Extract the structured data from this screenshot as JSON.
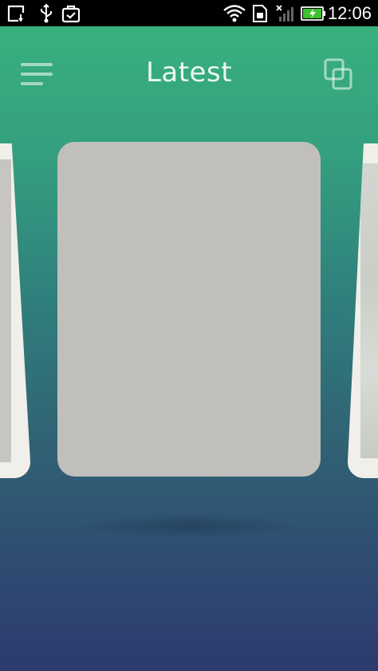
{
  "status_bar": {
    "time": "12:06",
    "icons": [
      "screenshot-icon",
      "usb-icon",
      "briefcase-icon",
      "wifi-icon",
      "sim-card-icon",
      "signal-icon",
      "battery-charging-icon"
    ]
  },
  "app_bar": {
    "title": "Latest",
    "menu_icon": "hamburger-menu-icon",
    "action_icon": "copy-icon"
  },
  "colors": {
    "gradient_top": "#38b47e",
    "gradient_bottom": "#2d3a6e",
    "card_placeholder": "#c1bfbb",
    "card_frame": "#f1efea"
  },
  "carousel": {
    "cards": [
      {
        "position": "left-partial"
      },
      {
        "position": "center"
      },
      {
        "position": "right-partial"
      }
    ]
  }
}
